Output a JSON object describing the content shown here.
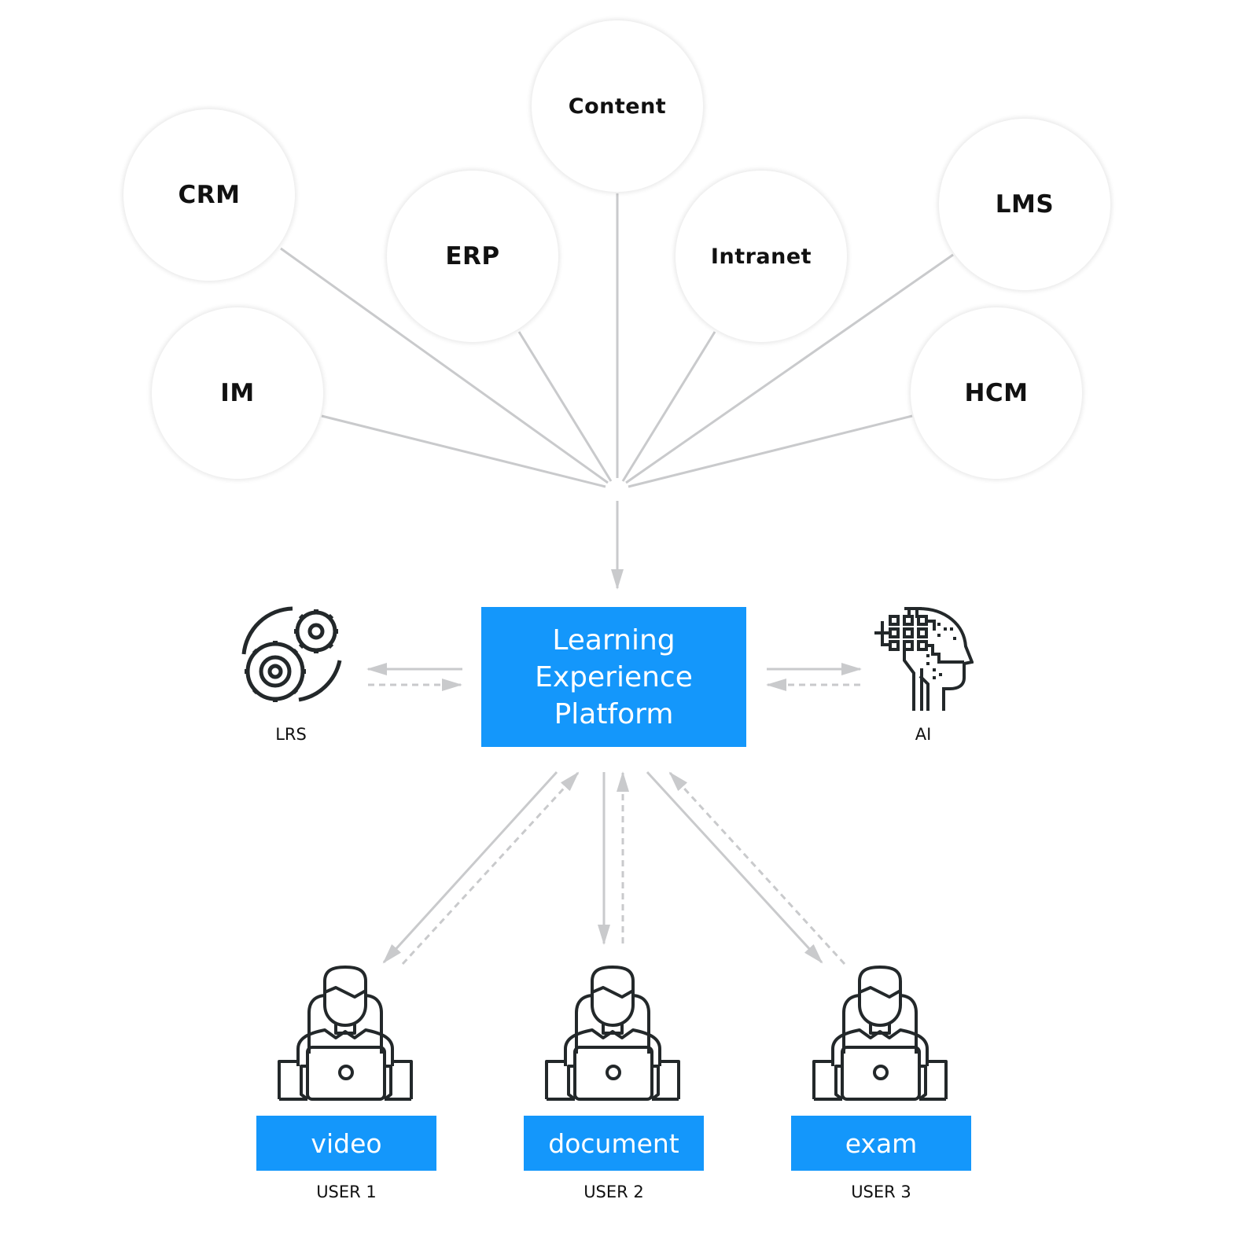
{
  "sources": [
    {
      "id": "crm",
      "label": "CRM"
    },
    {
      "id": "erp",
      "label": "ERP"
    },
    {
      "id": "content",
      "label": "Content"
    },
    {
      "id": "intranet",
      "label": "Intranet"
    },
    {
      "id": "lms",
      "label": "LMS"
    },
    {
      "id": "im",
      "label": "IM"
    },
    {
      "id": "hcm",
      "label": "HCM"
    }
  ],
  "center": {
    "line1": "Learning",
    "line2": "Experience",
    "line3": "Platform"
  },
  "services": {
    "lrs": {
      "label": "LRS",
      "icon": "gears-icon"
    },
    "ai": {
      "label": "AI",
      "icon": "ai-head-icon"
    }
  },
  "users": [
    {
      "content": "video",
      "label": "USER 1"
    },
    {
      "content": "document",
      "label": "USER 2"
    },
    {
      "content": "exam",
      "label": "USER 3"
    }
  ],
  "colors": {
    "accent": "#1497fb",
    "connector": "#c9cacc",
    "icon_stroke": "#23282a",
    "text": "#111111"
  }
}
